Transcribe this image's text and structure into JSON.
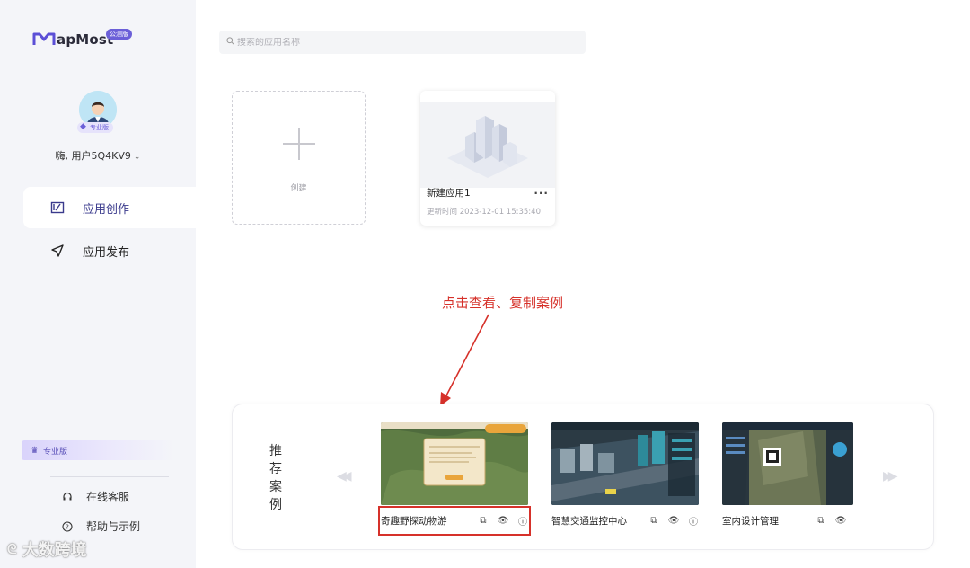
{
  "sidebar": {
    "logo_text": "apMost",
    "logo_letter": "M",
    "logo_badge": "公测版",
    "avatar_badge": "专业版",
    "username": "嗨, 用户5Q4KV9",
    "nav": [
      {
        "label": "应用创作",
        "icon": "edit-icon",
        "active": true
      },
      {
        "label": "应用发布",
        "icon": "send-icon",
        "active": false
      }
    ],
    "plan_banner": "专业版",
    "links": [
      {
        "label": "在线客服",
        "icon": "headset-icon"
      },
      {
        "label": "帮助与示例",
        "icon": "help-icon"
      }
    ],
    "watermark": "大数跨境"
  },
  "search": {
    "placeholder": "搜索的应用名称"
  },
  "create_card": {
    "label": "创建"
  },
  "apps": [
    {
      "title": "新建应用1",
      "updated": "更新时间 2023-12-01 15:35:40",
      "more": "···"
    }
  ],
  "annotation": "点击查看、复制案例",
  "recommended": {
    "label": "推荐案例",
    "cases": [
      {
        "name": "奇趣野探动物游"
      },
      {
        "name": "智慧交通监控中心"
      },
      {
        "name": "室内设计管理"
      }
    ]
  },
  "colors": {
    "accent": "#6b5fd8",
    "annotation": "#d6312a",
    "sidebar_bg": "#f4f5f9"
  }
}
